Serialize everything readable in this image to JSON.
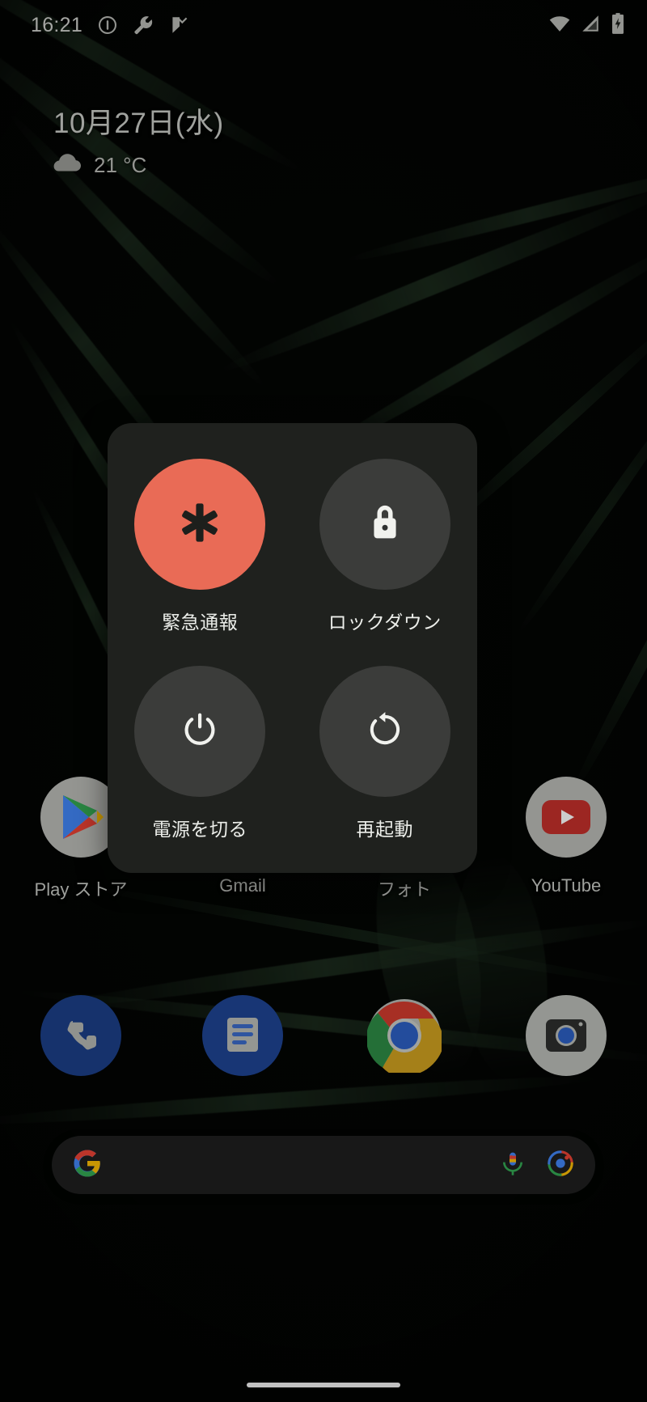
{
  "status_bar": {
    "clock": "16:21",
    "left_icons": [
      {
        "name": "do-not-disturb-icon",
        "glyph": "dnd"
      },
      {
        "name": "wrench-icon",
        "glyph": "wrench"
      },
      {
        "name": "checkmark-flag-icon",
        "glyph": "flag-check"
      }
    ],
    "right_icons": [
      {
        "name": "wifi-icon",
        "glyph": "wifi"
      },
      {
        "name": "cellular-signal-icon",
        "glyph": "signal"
      },
      {
        "name": "battery-charging-icon",
        "glyph": "battery-charging"
      }
    ]
  },
  "widget": {
    "date": "10月27日(水)",
    "weather_icon": "cloud-icon",
    "temperature": "21 °C"
  },
  "app_grid": [
    {
      "label": "Play ストア",
      "icon": "play-store-icon"
    },
    {
      "label": "Gmail",
      "icon": "gmail-icon"
    },
    {
      "label": "フォト",
      "icon": "photos-icon"
    },
    {
      "label": "YouTube",
      "icon": "youtube-icon"
    }
  ],
  "dock": [
    {
      "name": "phone",
      "icon": "phone-icon"
    },
    {
      "name": "messages",
      "icon": "messages-icon"
    },
    {
      "name": "chrome",
      "icon": "chrome-icon"
    },
    {
      "name": "camera",
      "icon": "camera-icon"
    }
  ],
  "search_bar": {
    "logo_icon": "google-g-icon",
    "mic_icon": "microphone-icon",
    "lens_icon": "google-lens-icon"
  },
  "power_menu": {
    "items": [
      {
        "label": "緊急通報",
        "icon": "emergency-star-of-life-icon",
        "style": "emergency",
        "color": "#e96b56"
      },
      {
        "label": "ロックダウン",
        "icon": "lock-icon",
        "style": "normal",
        "color": "#3b3c3a"
      },
      {
        "label": "電源を切る",
        "icon": "power-icon",
        "style": "normal",
        "color": "#3b3c3a"
      },
      {
        "label": "再起動",
        "icon": "restart-icon",
        "style": "normal",
        "color": "#3b3c3a"
      }
    ]
  },
  "colors": {
    "dialog_background": "#1f211e",
    "circle_background": "#3b3c3a",
    "emergency": "#e96b56",
    "text_primary": "#eceeea"
  }
}
